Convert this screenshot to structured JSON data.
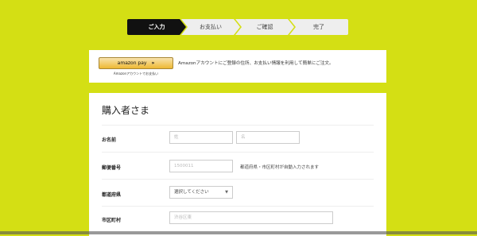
{
  "steps": [
    {
      "label": "ご入力",
      "active": true
    },
    {
      "label": "お支払い",
      "active": false
    },
    {
      "label": "ご確認",
      "active": false
    },
    {
      "label": "完了",
      "active": false
    }
  ],
  "amazon": {
    "button_label": "amazon pay",
    "button_arrows": "»",
    "button_sub": "Amazonアカウントでお支払い",
    "description": "Amazonアカウントにご登録の住所、お支払い情報を利用して簡単にご注文。"
  },
  "form": {
    "title": "購入者さま",
    "name": {
      "label": "お名前",
      "last_placeholder": "姓",
      "first_placeholder": "名"
    },
    "postal": {
      "label": "郵便番号",
      "placeholder": "1500011",
      "hint": "都道府県・市区町村が自動入力されます"
    },
    "prefecture": {
      "label": "都道府県",
      "value": "選択してください"
    },
    "city": {
      "label": "市区町村",
      "placeholder": "渋谷区東"
    }
  }
}
